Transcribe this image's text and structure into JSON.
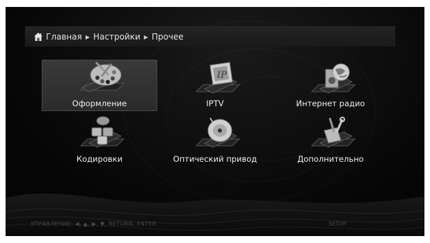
{
  "breadcrumb": {
    "items": [
      "Главная",
      "Настройки",
      "Прочее"
    ]
  },
  "menu": {
    "items": [
      {
        "label": "Оформление",
        "icon": "palette-icon",
        "selected": true
      },
      {
        "label": "IPTV",
        "icon": "iptv-icon",
        "selected": false
      },
      {
        "label": "Интернет радио",
        "icon": "internet-radio-icon",
        "selected": false
      },
      {
        "label": "Кодировки",
        "icon": "encoding-icon",
        "selected": false
      },
      {
        "label": "Оптический привод",
        "icon": "optical-drive-icon",
        "selected": false
      },
      {
        "label": "Дополнительно",
        "icon": "tools-icon",
        "selected": false
      }
    ]
  },
  "footer": {
    "controls": "УПРАВЛЕНИЕ:   ◀,   ▲,   ▶,   ▼,   RETURN, ENTER",
    "setup": "SETUP"
  },
  "colors": {
    "background": "#0d0d0d",
    "text": "#f0f0f0",
    "selected_tile": "#333333",
    "footer_text": "#4a4a4a"
  }
}
